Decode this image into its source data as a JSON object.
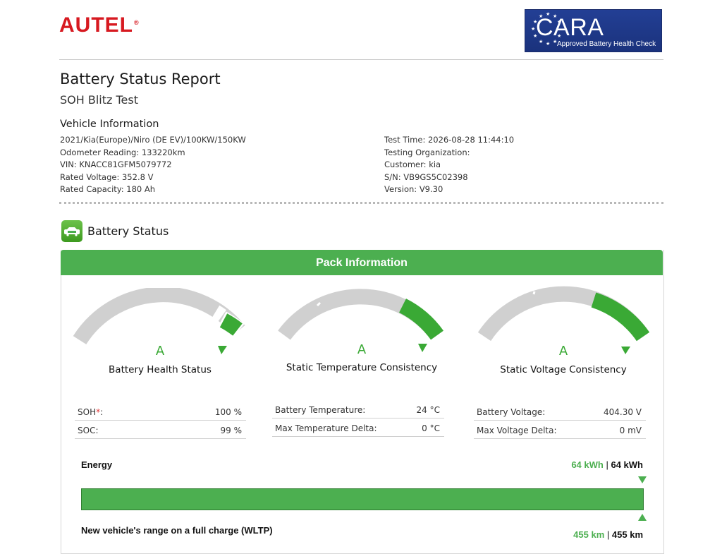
{
  "brand": {
    "logo_text": "AUTEL",
    "logo_color": "#d71920"
  },
  "badge": {
    "word": "CARA",
    "subtitle": "Approved Battery Health Check"
  },
  "report": {
    "title": "Battery Status Report",
    "subtitle": "SOH Blitz Test"
  },
  "vehicle_info": {
    "heading": "Vehicle Information",
    "left": [
      "2021/Kia(Europe)/Niro (DE EV)/100KW/150KW",
      "Odometer Reading: 133220km",
      "VIN: KNACC81GFM5079772",
      "Rated Voltage: 352.8 V",
      "Rated Capacity: 180 Ah"
    ],
    "right": [
      "Test Time: 2026-08-28 11:44:10",
      "Testing Organization:",
      "Customer: kia",
      "S/N: VB9GS5C02398",
      "Version: V9.30"
    ]
  },
  "battery_status": {
    "heading": "Battery Status",
    "icon": "battery-car-icon"
  },
  "pack": {
    "header": "Pack Information",
    "accent": "#4caf50",
    "gauges": [
      {
        "grade": "A",
        "label": "Battery Health Status"
      },
      {
        "grade": "A",
        "label": "Static Temperature Consistency"
      },
      {
        "grade": "A",
        "label": "Static Voltage Consistency"
      }
    ],
    "tables": [
      [
        {
          "label": "SOH",
          "star": "*",
          "suffix": ":",
          "value": "100 %"
        },
        {
          "label": "SOC:",
          "star": "",
          "suffix": "",
          "value": "99 %"
        }
      ],
      [
        {
          "label": "Battery Temperature:",
          "star": "",
          "suffix": "",
          "value": "24 °C"
        },
        {
          "label": "Max Temperature Delta:",
          "star": "",
          "suffix": "",
          "value": "0 °C"
        }
      ],
      [
        {
          "label": "Battery Voltage:",
          "star": "",
          "suffix": "",
          "value": "404.30 V"
        },
        {
          "label": "Max Voltage Delta:",
          "star": "",
          "suffix": "",
          "value": "0 mV"
        }
      ]
    ]
  },
  "energy": {
    "label": "Energy",
    "current": "64 kWh",
    "separator": "|",
    "rated": "64 kWh",
    "fill_fraction": 1.0
  },
  "range": {
    "label": "New vehicle's range on a full charge (WLTP)",
    "current": "455 km",
    "separator": "|",
    "rated": "455 km"
  }
}
